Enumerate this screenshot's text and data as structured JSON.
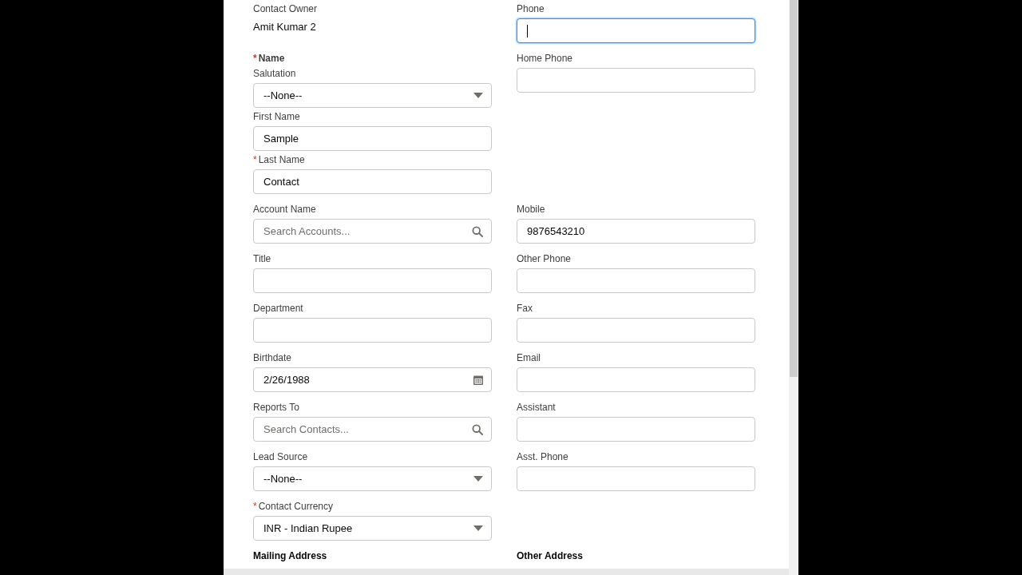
{
  "required_marker": "*",
  "rows": [
    {
      "left": {
        "kind": "static",
        "label": "Contact Owner",
        "required": false,
        "value": "Amit Kumar 2"
      },
      "right": {
        "kind": "input",
        "label": "Phone",
        "required": false,
        "focused": true
      }
    },
    {
      "left": {
        "kind": "group",
        "label": "Name",
        "required": true,
        "children": [
          {
            "kind": "select",
            "label": "Salutation",
            "required": false,
            "value": "--None--"
          },
          {
            "kind": "input",
            "label": "First Name",
            "required": false,
            "focused": false,
            "value": "Sample"
          },
          {
            "kind": "input",
            "label": "Last Name",
            "required": true,
            "focused": false,
            "value": "Contact"
          }
        ]
      },
      "right": {
        "kind": "input",
        "label": "Home Phone",
        "required": false,
        "focused": false
      }
    },
    {
      "left": {
        "kind": "lookup",
        "label": "Account Name",
        "required": false,
        "placeholder": "Search Accounts..."
      },
      "right": {
        "kind": "input",
        "label": "Mobile",
        "required": false,
        "focused": false,
        "value": "9876543210"
      }
    },
    {
      "left": {
        "kind": "input",
        "label": "Title",
        "required": false,
        "focused": false
      },
      "right": {
        "kind": "input",
        "label": "Other Phone",
        "required": false,
        "focused": false
      }
    },
    {
      "left": {
        "kind": "input",
        "label": "Department",
        "required": false,
        "focused": false
      },
      "right": {
        "kind": "input",
        "label": "Fax",
        "required": false,
        "focused": false
      }
    },
    {
      "left": {
        "kind": "date",
        "label": "Birthdate",
        "required": false,
        "value": "2/26/1988"
      },
      "right": {
        "kind": "input",
        "label": "Email",
        "required": false,
        "focused": false
      }
    },
    {
      "left": {
        "kind": "lookup",
        "label": "Reports To",
        "required": false,
        "placeholder": "Search Contacts..."
      },
      "right": {
        "kind": "input",
        "label": "Assistant",
        "required": false,
        "focused": false
      }
    },
    {
      "left": {
        "kind": "select",
        "label": "Lead Source",
        "required": false,
        "value": "--None--"
      },
      "right": {
        "kind": "input",
        "label": "Asst. Phone",
        "required": false,
        "focused": false
      }
    },
    {
      "left": {
        "kind": "select",
        "label": "Contact Currency",
        "required": true,
        "value": "INR - Indian Rupee"
      }
    },
    {
      "left": {
        "kind": "heading",
        "label": "Mailing Address"
      },
      "right": {
        "kind": "heading",
        "label": "Other Address"
      }
    }
  ]
}
